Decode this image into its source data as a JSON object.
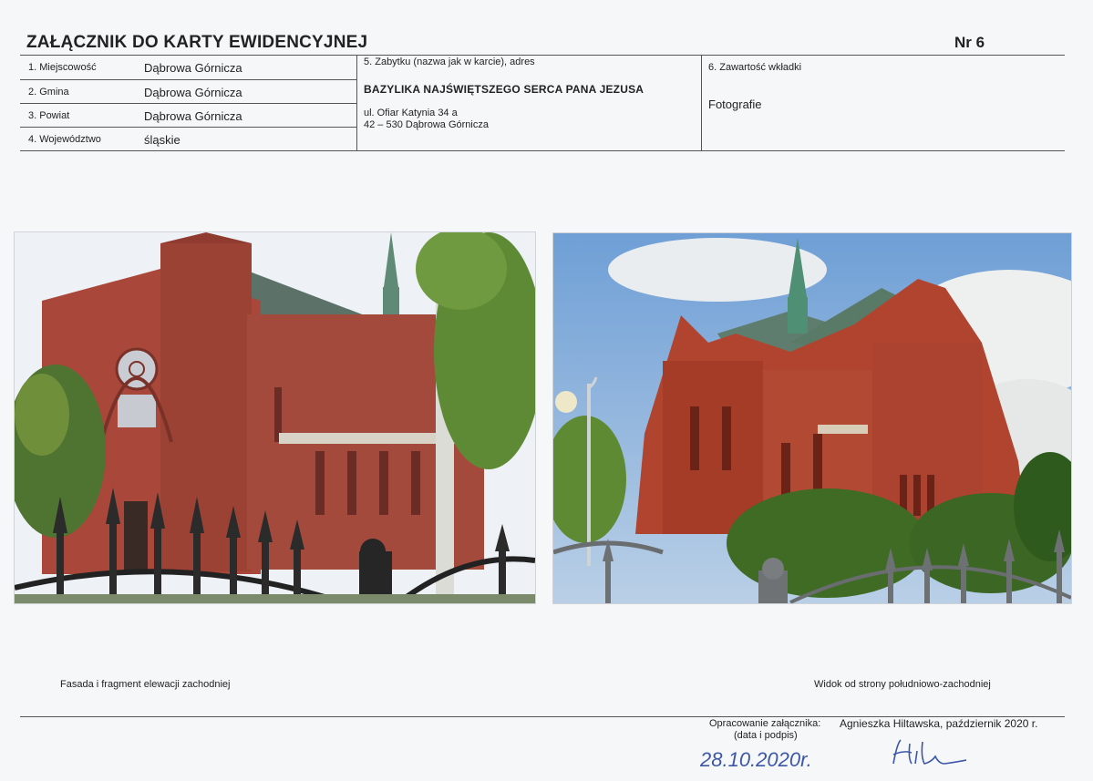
{
  "header": {
    "title": "ZAŁĄCZNIK DO KARTY EWIDENCYJNEJ",
    "number": "Nr 6"
  },
  "form": {
    "rows": [
      {
        "label": "1. Miejscowość",
        "value": "Dąbrowa Górnicza"
      },
      {
        "label": "2. Gmina",
        "value": "Dąbrowa Górnicza"
      },
      {
        "label": "3. Powiat",
        "value": "Dąbrowa Górnicza"
      },
      {
        "label": "4. Województwo",
        "value": "śląskie"
      }
    ],
    "monument": {
      "label": "5. Zabytku (nazwa jak w karcie), adres",
      "name": "BAZYLIKA NAJŚWIĘTSZEGO SERCA PANA JEZUSA",
      "address_line1": "ul. Ofiar Katynia 34 a",
      "address_line2": "42 – 530 Dąbrowa Górnicza"
    },
    "contents": {
      "label": "6. Zawartość wkładki",
      "value": "Fotografie"
    }
  },
  "photos": [
    {
      "caption": "Fasada i fragment elewacji zachodniej"
    },
    {
      "caption": "Widok od strony południowo-zachodniej"
    }
  ],
  "footer": {
    "prepared_label": "Opracowanie załącznika:",
    "prepared_sub": "(data i podpis)",
    "prepared_value": "Agnieszka Hiltawska, październik 2020 r.",
    "handwritten_date": "28.10.2020r.",
    "signature": "Hilta"
  },
  "colors": {
    "brick": "#a9483a",
    "roof": "#5c7268",
    "sky_left": "#e8eef5",
    "sky_right": "#7fa9d8",
    "ink_handwriting": "#3d57a8"
  }
}
